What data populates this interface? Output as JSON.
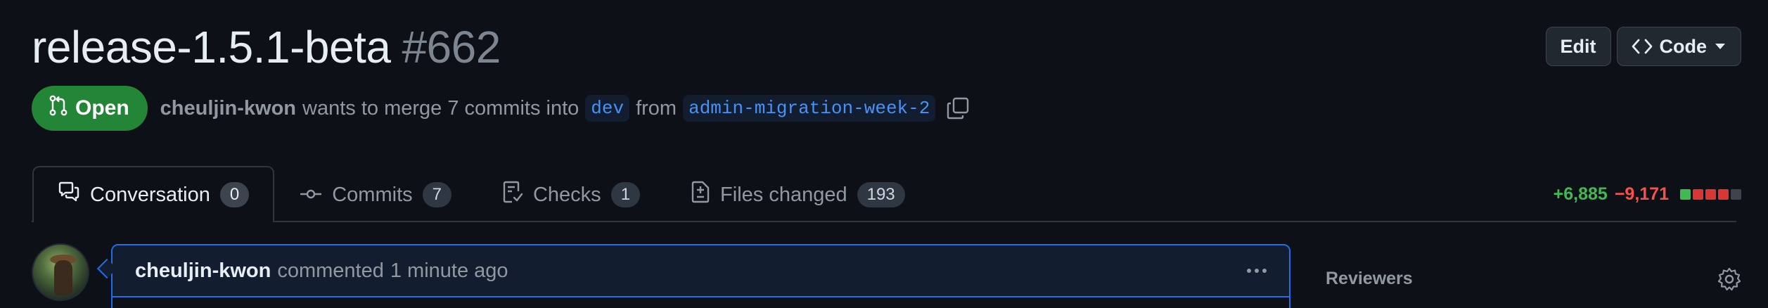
{
  "header": {
    "title": "release-1.5.1-beta",
    "number": "#662",
    "edit_label": "Edit",
    "code_label": "Code"
  },
  "meta": {
    "state": "Open",
    "author": "cheuljin-kwon",
    "text_1": "wants to merge 7 commits into",
    "base_branch": "dev",
    "text_2": "from",
    "head_branch": "admin-migration-week-2"
  },
  "tabs": [
    {
      "label": "Conversation",
      "count": "0",
      "icon": "comment-discussion-icon",
      "active": true
    },
    {
      "label": "Commits",
      "count": "7",
      "icon": "git-commit-icon",
      "active": false
    },
    {
      "label": "Checks",
      "count": "1",
      "icon": "checklist-icon",
      "active": false
    },
    {
      "label": "Files changed",
      "count": "193",
      "icon": "file-diff-icon",
      "active": false
    }
  ],
  "diffstat": {
    "additions": "+6,885",
    "deletions": "−9,171",
    "blocks": [
      "green",
      "red",
      "red",
      "red",
      "gray"
    ]
  },
  "comment": {
    "author": "cheuljin-kwon",
    "action": "commented",
    "time": "1 minute ago"
  },
  "sidebar": {
    "reviewers_title": "Reviewers"
  },
  "colors": {
    "background": "#0d1117",
    "open_green": "#238636",
    "link_blue": "#4493f8",
    "add_green": "#3fb950",
    "del_red": "#f85149"
  }
}
